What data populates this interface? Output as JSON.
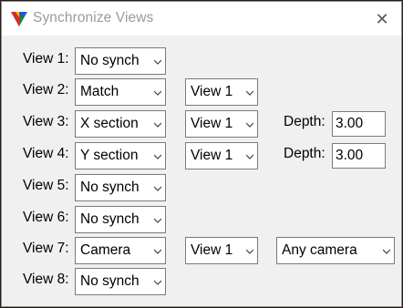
{
  "window": {
    "title": "Synchronize Views",
    "close_glyph": "✕"
  },
  "rows": [
    {
      "label": "View 1:",
      "mode": "No synch"
    },
    {
      "label": "View 2:",
      "mode": "Match",
      "view": "View 1"
    },
    {
      "label": "View 3:",
      "mode": "X section",
      "view": "View 1",
      "depth_label": "Depth:",
      "depth": "3.00"
    },
    {
      "label": "View 4:",
      "mode": "Y section",
      "view": "View 1",
      "depth_label": "Depth:",
      "depth": "3.00"
    },
    {
      "label": "View 5:",
      "mode": "No synch"
    },
    {
      "label": "View 6:",
      "mode": "No synch"
    },
    {
      "label": "View 7:",
      "mode": "Camera",
      "view": "View 1",
      "camera": "Any camera"
    },
    {
      "label": "View 8:",
      "mode": "No synch"
    }
  ],
  "icons": {
    "app": "triangle-logo-icon",
    "dropdown": "chevron-down-icon",
    "close": "close-icon"
  }
}
